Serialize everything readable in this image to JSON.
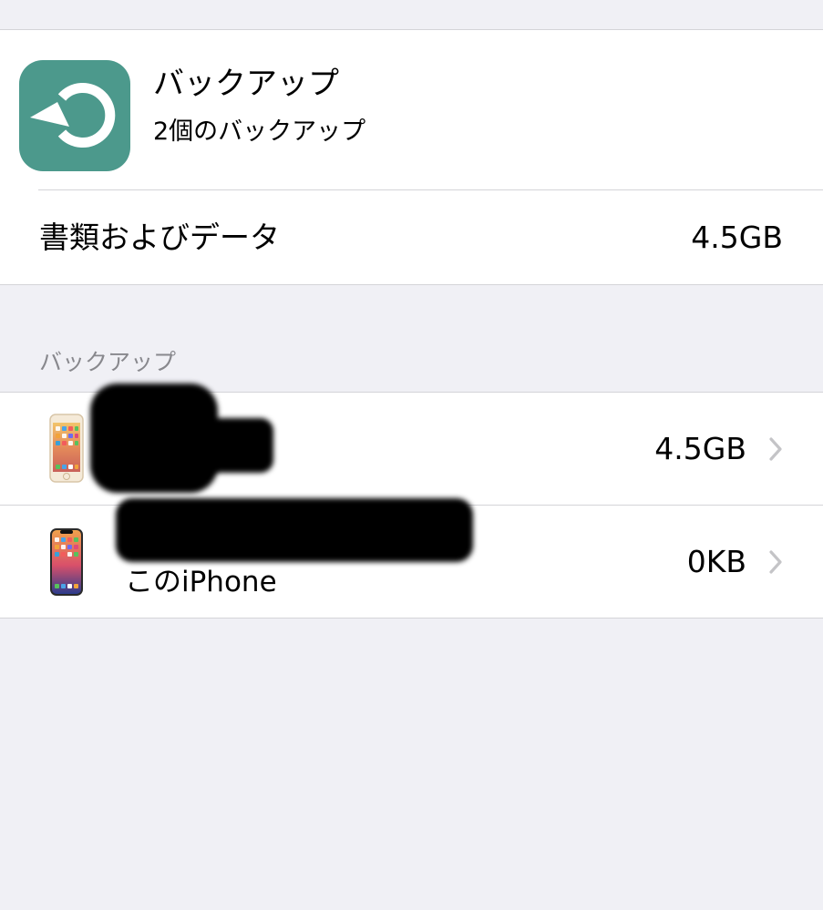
{
  "header": {
    "title": "バックアップ",
    "subtitle": "2個のバックアップ"
  },
  "documents_row": {
    "label": "書類およびデータ",
    "value": "4.5GB"
  },
  "backups_section": {
    "header": "バックアップ",
    "items": [
      {
        "name": "",
        "size": "4.5GB",
        "device_icon": "iphone-gold-home-button-icon"
      },
      {
        "name": "このiPhone",
        "size": "0KB",
        "device_icon": "iphone-notch-icon"
      }
    ]
  },
  "colors": {
    "background": "#f0f0f5",
    "icon_teal": "#4c998c",
    "secondary_text": "#88888d",
    "chevron": "#c4c4c7"
  }
}
